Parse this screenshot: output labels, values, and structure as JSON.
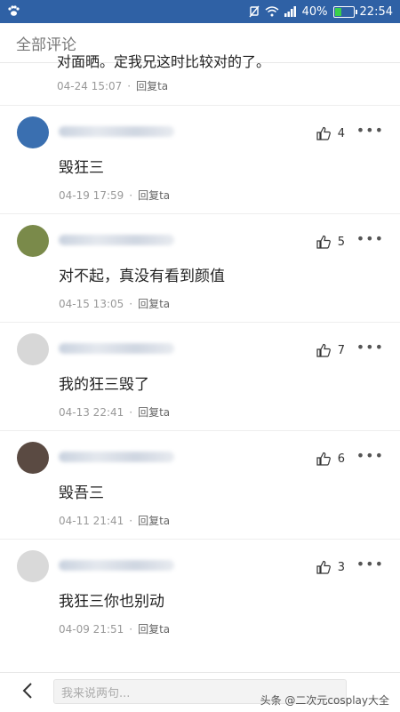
{
  "status_bar": {
    "battery": "40%",
    "time": "22:54",
    "battery_level": 0.4
  },
  "header": {
    "title": "全部评论"
  },
  "partial_top": {
    "text": "对面晒。定我兄这时比较对的了。",
    "timestamp": "04-24 15:07",
    "reply_label": "回复ta"
  },
  "comments": [
    {
      "likes": "4",
      "text": "毁狂三",
      "timestamp": "04-19 17:59",
      "reply_label": "回复ta",
      "avatar_color": "#3a6fb0"
    },
    {
      "likes": "5",
      "text": "对不起，真没有看到颜值",
      "timestamp": "04-15 13:05",
      "reply_label": "回复ta",
      "avatar_color": "#7a8a4a"
    },
    {
      "likes": "7",
      "text": "我的狂三毁了",
      "timestamp": "04-13 22:41",
      "reply_label": "回复ta",
      "avatar_color": "#d7d7d7"
    },
    {
      "likes": "6",
      "text": "毁吾三",
      "timestamp": "04-11 21:41",
      "reply_label": "回复ta",
      "avatar_color": "#5a4a42"
    },
    {
      "likes": "3",
      "text": "我狂三你也别动",
      "timestamp": "04-09 21:51",
      "reply_label": "回复ta",
      "avatar_color": "#d9d9d9"
    }
  ],
  "bottom_bar": {
    "input_placeholder": "我来说两句...",
    "watermark": "头条 @二次元cosplay大全"
  }
}
